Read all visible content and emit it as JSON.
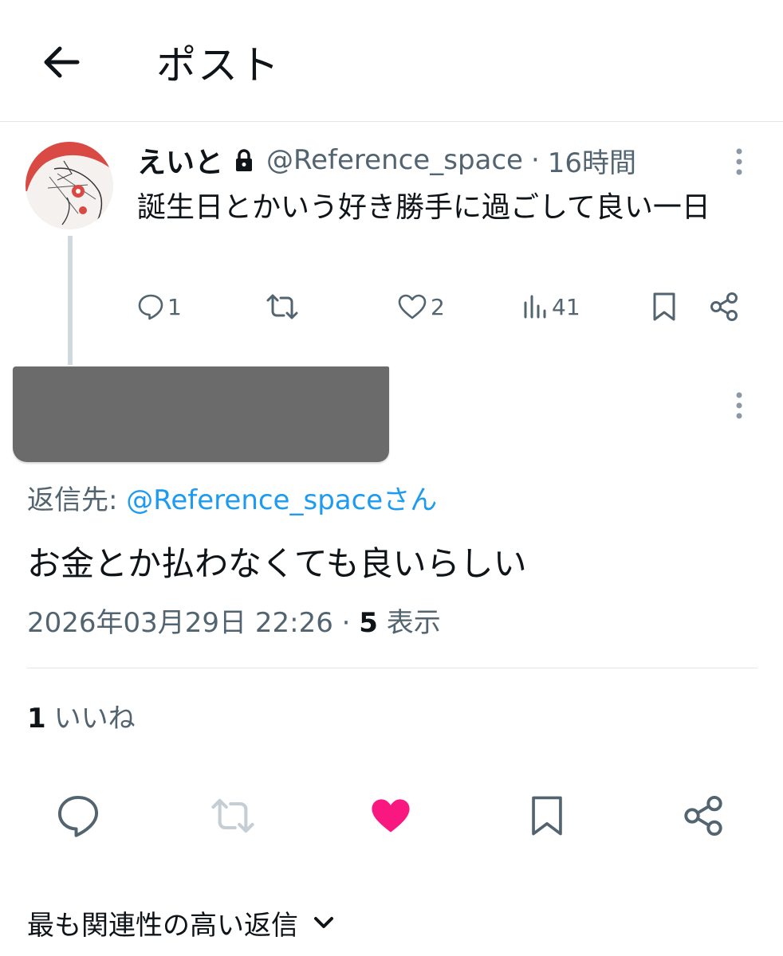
{
  "header": {
    "title": "ポスト"
  },
  "parent_post": {
    "author_name": "えいと",
    "handle": "@Reference_space",
    "separator": "·",
    "time": "16時間",
    "text": "誕生日とかいう好き勝手に過ごして良い一日",
    "actions": {
      "reply_count": "1",
      "like_count": "2",
      "view_count": "41"
    }
  },
  "focus_post": {
    "reply_prefix": "返信先: ",
    "reply_target": "@Reference_spaceさん",
    "text": "お金とか払わなくても良いらしい",
    "timestamp": "2026年03月29日 22:26",
    "separator": " · ",
    "views_count": "5",
    "views_label": " 表示",
    "likes_count": "1",
    "likes_label": "いいね"
  },
  "replies_sort": {
    "label": "最も関連性の高い返信"
  },
  "icons": {
    "back": "arrow-left-icon",
    "lock": "lock-icon",
    "more": "more-vertical-icon",
    "reply": "comment-icon",
    "repost": "repost-icon",
    "like": "heart-icon",
    "views": "bar-chart-icon",
    "bookmark": "bookmark-icon",
    "share": "share-icon",
    "chevron": "chevron-down-icon"
  },
  "colors": {
    "text_primary": "#0f1419",
    "text_secondary": "#536471",
    "link": "#1d9bf0",
    "like_active": "#f91880",
    "thread_line": "#cfd9de",
    "redacted": "#6b6b6b"
  }
}
